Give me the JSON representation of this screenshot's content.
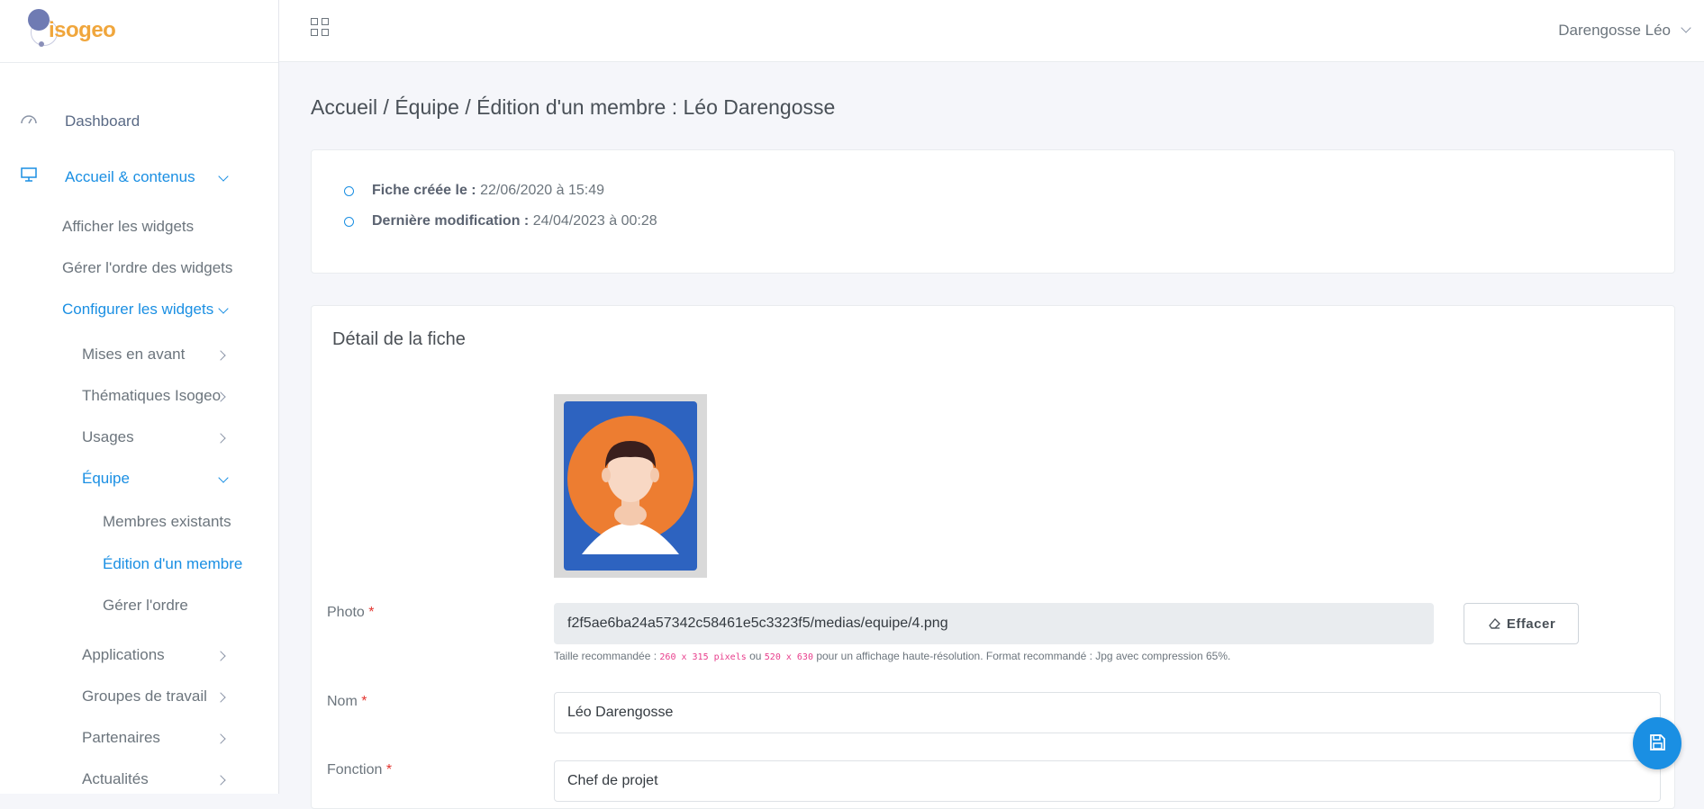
{
  "brand": {
    "name": "isogeo"
  },
  "topbar": {
    "user_name": "Darengosse Léo"
  },
  "sidebar": {
    "dashboard": "Dashboard",
    "accueil": "Accueil & contenus",
    "afficher_widgets": "Afficher les widgets",
    "gerer_ordre_widgets": "Gérer l'ordre des widgets",
    "configurer_widgets": "Configurer les widgets",
    "mises_en_avant": "Mises en avant",
    "thematiques": "Thématiques Isogeo",
    "usages": "Usages",
    "equipe": "Équipe",
    "membres_existants": "Membres existants",
    "edition_membre": "Édition d'un membre",
    "gerer_ordre": "Gérer l'ordre",
    "applications": "Applications",
    "groupes_travail": "Groupes de travail",
    "partenaires": "Partenaires",
    "actualites": "Actualités"
  },
  "page": {
    "breadcrumb": "Accueil / Équipe / Édition d'un membre : Léo Darengosse",
    "created_label": "Fiche créée le :",
    "created_value": "22/06/2020 à 15:49",
    "modified_label": "Dernière modification :",
    "modified_value": "24/04/2023 à 00:28"
  },
  "detail": {
    "title": "Détail de la fiche",
    "photo_label": "Photo",
    "photo_value": "f2f5ae6ba24a57342c58461e5c3323f5/medias/equipe/4.png",
    "clear_button": "Effacer",
    "help_prefix": "Taille recommandée :",
    "help_size1": "260 x 315 pixels",
    "help_or": "ou",
    "help_size2": "520 x 630",
    "help_suffix": "pour un affichage haute-résolution. Format recommandé : Jpg avec compression 65%.",
    "name_label": "Nom",
    "name_value": "Léo Darengosse",
    "function_label": "Fonction",
    "function_value": "Chef de projet",
    "required_mark": "*"
  },
  "icons": {
    "dashboard": "gauge-icon",
    "accueil": "presentation-icon",
    "apps": "grid-icon",
    "clear": "eraser-icon",
    "save": "save-icon"
  },
  "colors": {
    "accent": "#1a8fe3",
    "brand": "#f0a63c",
    "required": "#e3342f"
  }
}
